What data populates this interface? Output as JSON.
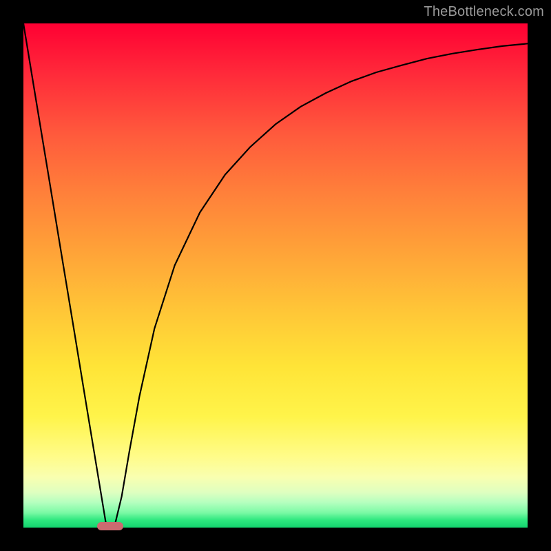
{
  "watermark": "TheBottleneck.com",
  "chart_data": {
    "type": "line",
    "title": "",
    "xlabel": "",
    "ylabel": "",
    "xlim": [
      0,
      1
    ],
    "ylim": [
      0,
      1
    ],
    "x": [
      0.0,
      0.025,
      0.05,
      0.075,
      0.1,
      0.125,
      0.15,
      0.165,
      0.18,
      0.195,
      0.21,
      0.23,
      0.26,
      0.3,
      0.35,
      0.4,
      0.45,
      0.5,
      0.55,
      0.6,
      0.65,
      0.7,
      0.75,
      0.8,
      0.85,
      0.9,
      0.95,
      1.0
    ],
    "values": [
      1.0,
      0.848,
      0.697,
      0.545,
      0.394,
      0.242,
      0.091,
      0.0,
      0.0,
      0.062,
      0.15,
      0.26,
      0.395,
      0.52,
      0.625,
      0.7,
      0.755,
      0.8,
      0.835,
      0.862,
      0.885,
      0.903,
      0.917,
      0.93,
      0.94,
      0.948,
      0.955,
      0.96
    ],
    "marker": {
      "x": 0.172,
      "y": 0.0
    },
    "gradient_stops": [
      {
        "pos": 0.0,
        "color": "#ff0033"
      },
      {
        "pos": 0.5,
        "color": "#ffc637"
      },
      {
        "pos": 0.86,
        "color": "#fffc8a"
      },
      {
        "pos": 1.0,
        "color": "#13d36e"
      }
    ]
  }
}
